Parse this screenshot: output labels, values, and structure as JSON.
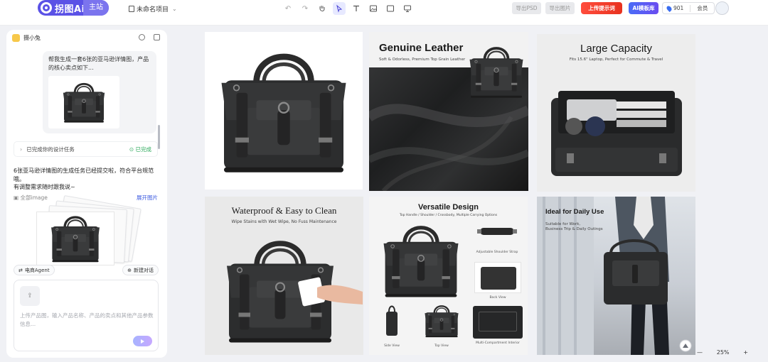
{
  "header": {
    "logo_text": "拐图Ai",
    "site_label": "主站",
    "project_name": "未命名项目",
    "export_psd": "导出PSD",
    "export_image": "导出图片",
    "hot_button": "上传提示词",
    "ai_button": "AI模板库",
    "points": "901",
    "member": "会员"
  },
  "panel": {
    "assistant_name": "摄小兔",
    "user_message": "帮我生成一套6张的亚马逊详情图，产品的核心卖点如下...",
    "task_label": "已完成你的设计任务",
    "task_status": "已完成",
    "reply_line1": "6张亚马逊详情图的生成任务已经提交啦，符合平台规范哦。",
    "reply_line2": "有调整需求随时跟我说~",
    "image_label": "全部image",
    "expand_label": "展开图片",
    "agent_label": "电商Agent",
    "new_chat_label": "新建对话",
    "input_placeholder": "上传产品图，输入产品名称、产品的卖点和其他产品参数信息..."
  },
  "cards": {
    "leather_title": "Genuine Leather",
    "leather_sub": "Soft & Odorless, Premium Top Grain Leather",
    "capacity_title": "Large Capacity",
    "capacity_sub": "Fits 15.6\" Laptop, Perfect for Commute & Travel",
    "waterproof_title": "Waterproof & Easy to Clean",
    "waterproof_sub": "Wipe Stains with Wet Wipe, No Fuss Maintenance",
    "versatile_title": "Versatile Design",
    "versatile_sub": "Top Handle / Shoulder / Crossbody, Multiple Carrying Options",
    "versatile_strap": "Adjustable Shoulder Strap",
    "versatile_back": "Back View",
    "versatile_side": "Side View",
    "versatile_top": "Top View",
    "versatile_inner": "Multi-Compartment Interior",
    "daily_title": "Ideal for Daily Use",
    "daily_sub1": "Suitable for Work,",
    "daily_sub2": "Business Trip & Daily Outings"
  },
  "zoom": {
    "minus": "—",
    "value": "25%",
    "plus": "+"
  },
  "colors": {
    "brand": "#5b52e6",
    "hot": "#ff4d3d",
    "status_done": "#2aa85a",
    "link": "#3b5ae0"
  }
}
